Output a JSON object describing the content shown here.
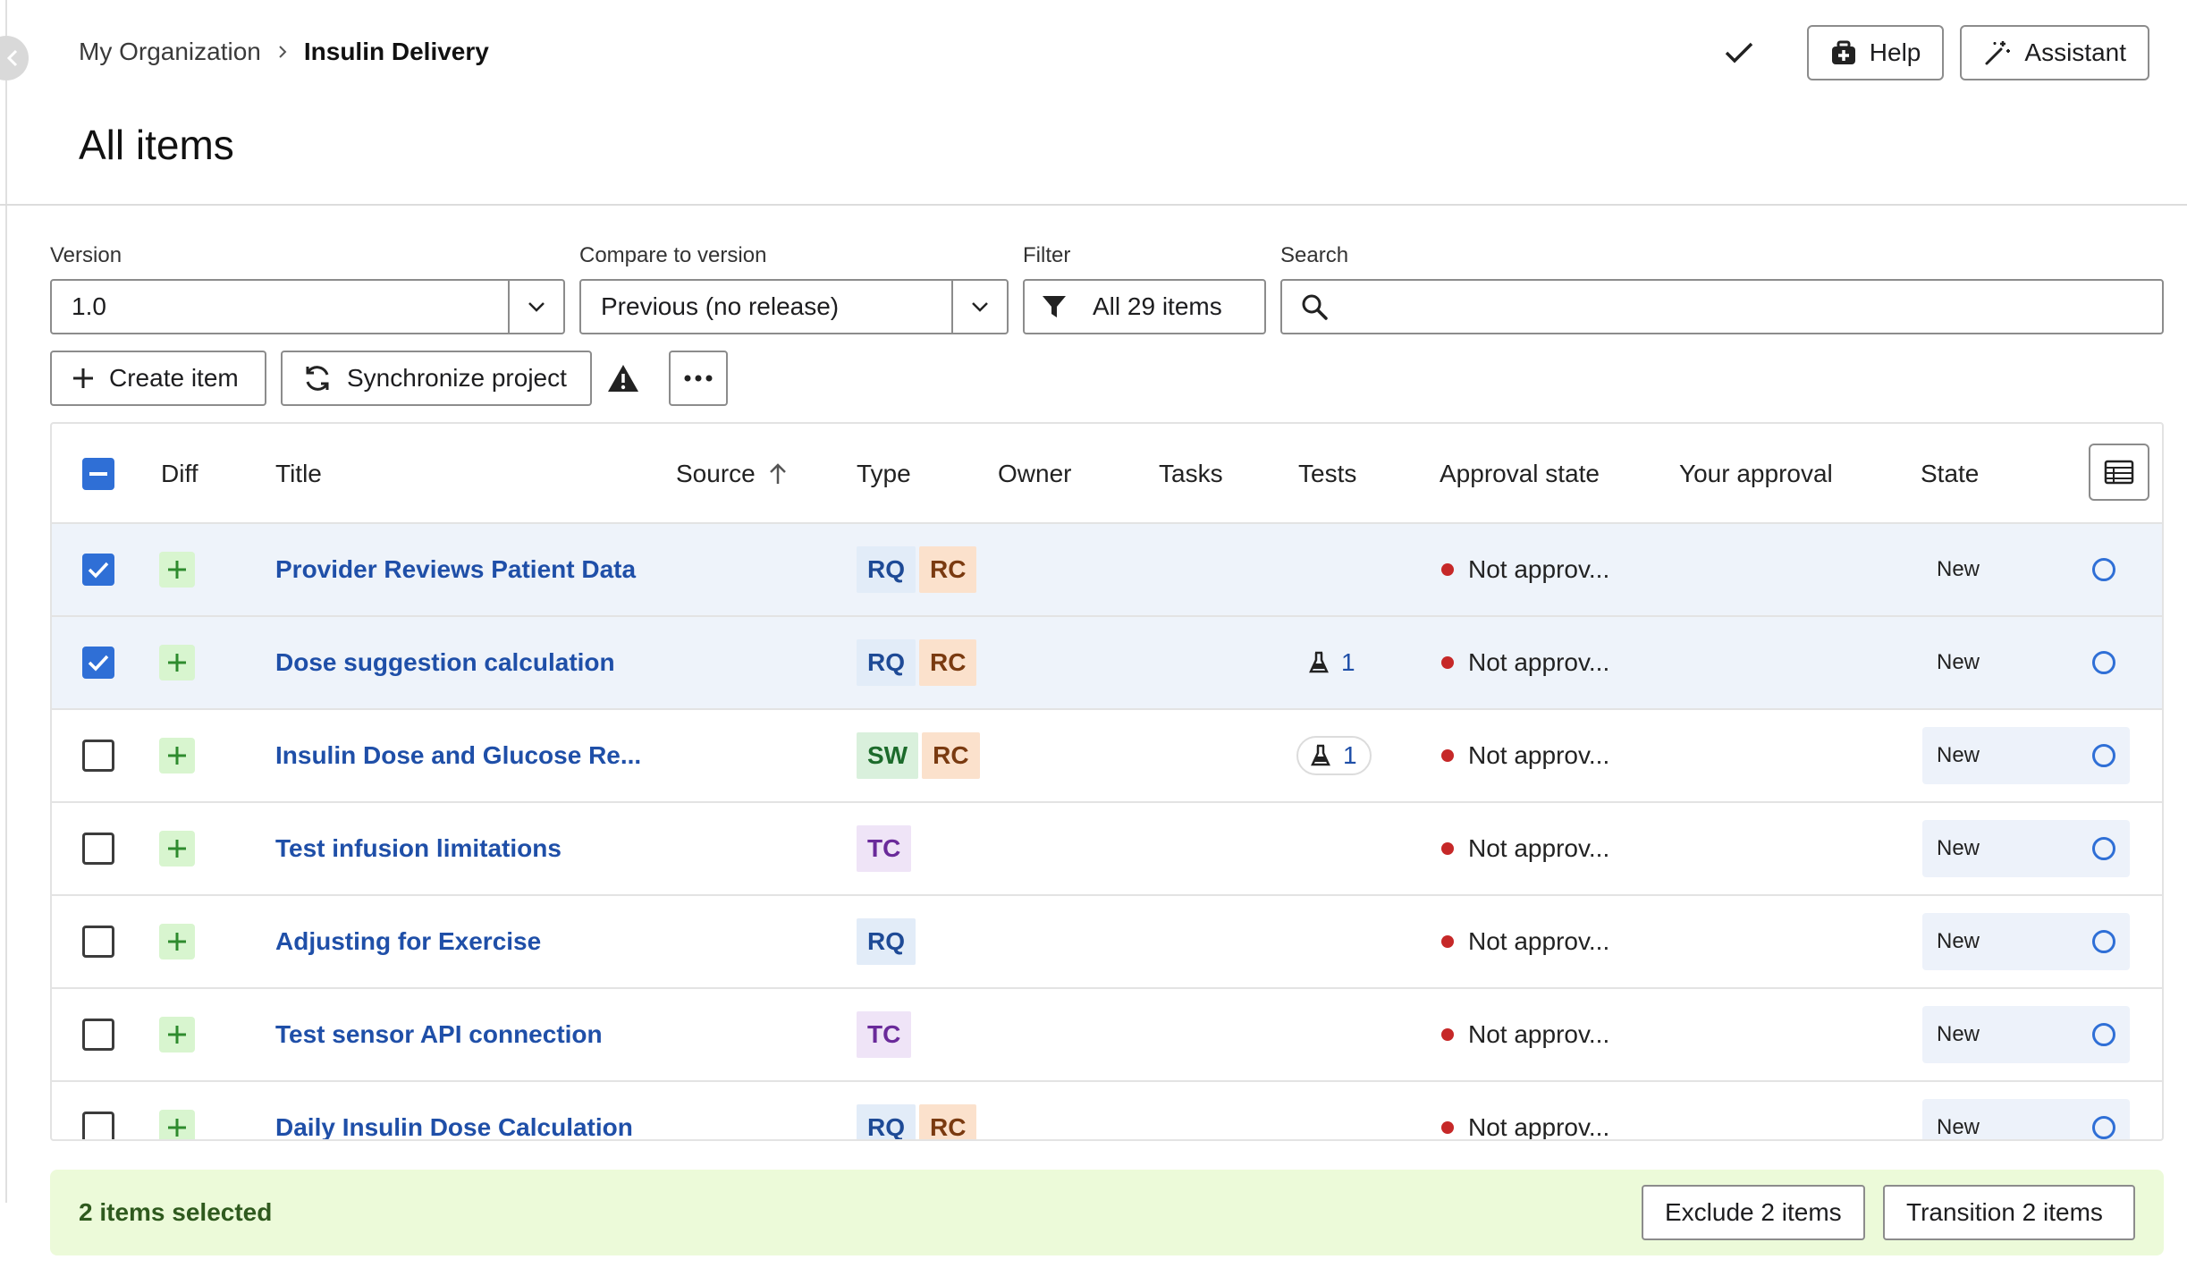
{
  "breadcrumb": {
    "org": "My Organization",
    "current": "Insulin Delivery"
  },
  "page_title": "All items",
  "header_buttons": {
    "help": "Help",
    "assistant": "Assistant"
  },
  "filters": {
    "version_label": "Version",
    "version_value": "1.0",
    "compare_label": "Compare to version",
    "compare_value": "Previous (no release)",
    "filter_label": "Filter",
    "filter_value": "All 29 items",
    "search_label": "Search",
    "search_placeholder": ""
  },
  "toolbar": {
    "create": "Create item",
    "sync": "Synchronize project"
  },
  "columns": {
    "diff": "Diff",
    "title": "Title",
    "source": "Source",
    "type": "Type",
    "owner": "Owner",
    "tasks": "Tasks",
    "tests": "Tests",
    "approval_state": "Approval state",
    "your_approval": "Your approval",
    "state": "State"
  },
  "rows": [
    {
      "title": "Provider Reviews Patient Data",
      "types": [
        "RQ",
        "RC"
      ],
      "tests": "",
      "approval": "Not approv...",
      "state": "New",
      "selected": true
    },
    {
      "title": "Dose suggestion calculation",
      "types": [
        "RQ",
        "RC"
      ],
      "tests": "1",
      "approval": "Not approv...",
      "state": "New",
      "selected": true
    },
    {
      "title": "Insulin Dose and Glucose Re...",
      "types": [
        "SW",
        "RC"
      ],
      "tests": "1",
      "approval": "Not approv...",
      "state": "New",
      "selected": false
    },
    {
      "title": "Test infusion limitations",
      "types": [
        "TC"
      ],
      "tests": "",
      "approval": "Not approv...",
      "state": "New",
      "selected": false
    },
    {
      "title": "Adjusting for Exercise",
      "types": [
        "RQ"
      ],
      "tests": "",
      "approval": "Not approv...",
      "state": "New",
      "selected": false
    },
    {
      "title": "Test sensor API connection",
      "types": [
        "TC"
      ],
      "tests": "",
      "approval": "Not approv...",
      "state": "New",
      "selected": false
    },
    {
      "title": "Daily Insulin Dose Calculation",
      "types": [
        "RQ",
        "RC"
      ],
      "tests": "",
      "approval": "Not approv...",
      "state": "New",
      "selected": false
    }
  ],
  "selection": {
    "text": "2 items selected",
    "exclude": "Exclude 2 items",
    "transition": "Transition 2 items"
  },
  "colors": {
    "accent": "#2f6fd6",
    "link": "#1f4fa8",
    "not_approved_dot": "#c62828",
    "selection_bar": "#ecfad9"
  }
}
